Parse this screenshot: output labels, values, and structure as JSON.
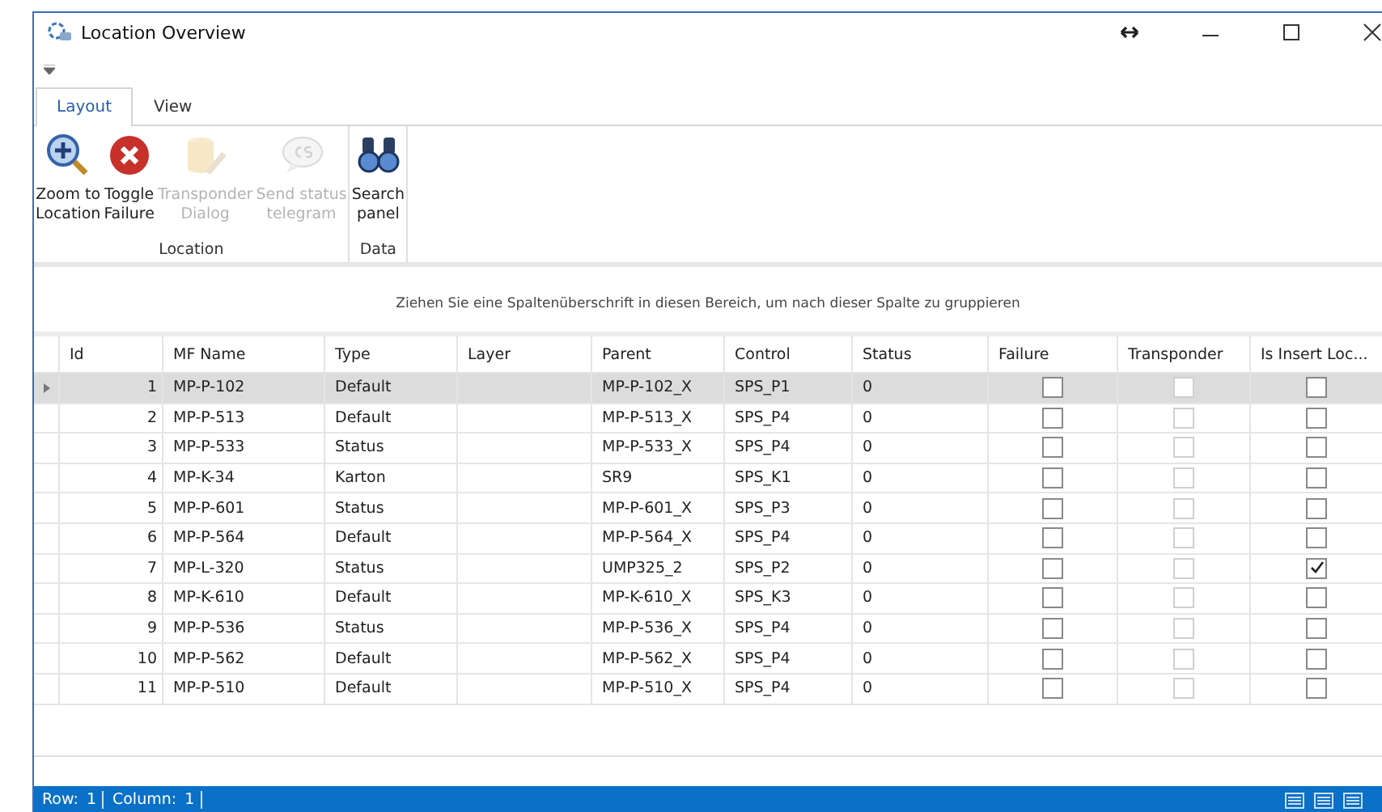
{
  "window": {
    "title": "Location Overview"
  },
  "tabs": [
    {
      "label": "Layout",
      "selected": true
    },
    {
      "label": "View",
      "selected": false
    }
  ],
  "ribbon_groups": [
    {
      "label": "Location",
      "buttons": [
        {
          "kind": "zoom",
          "lines": [
            "Zoom to",
            "Location"
          ],
          "disabled": false
        },
        {
          "kind": "failure",
          "lines": [
            "Toggle",
            "Failure"
          ],
          "disabled": false
        },
        {
          "kind": "dialog",
          "lines": [
            "Transponder",
            "Dialog"
          ],
          "disabled": true
        },
        {
          "kind": "telegram",
          "lines": [
            "Send status",
            "telegram"
          ],
          "disabled": true
        }
      ]
    },
    {
      "label": "Data",
      "buttons": [
        {
          "kind": "search",
          "lines": [
            "Search",
            "panel"
          ],
          "disabled": false
        }
      ]
    }
  ],
  "group_panel_hint": "Ziehen Sie eine Spaltenüberschrift in diesen Bereich, um nach dieser Spalte zu gruppieren",
  "table": {
    "columns": [
      {
        "label": "Id",
        "kind": "number"
      },
      {
        "label": "MF Name",
        "kind": "text"
      },
      {
        "label": "Type",
        "kind": "text"
      },
      {
        "label": "Layer",
        "kind": "text"
      },
      {
        "label": "Parent",
        "kind": "text"
      },
      {
        "label": "Control",
        "kind": "text"
      },
      {
        "label": "Status",
        "kind": "text"
      },
      {
        "label": "Failure",
        "kind": "check",
        "disabled": false
      },
      {
        "label": "Transponder",
        "kind": "check",
        "disabled": true
      },
      {
        "label": "Is Insert Loc...",
        "kind": "check",
        "disabled": false
      }
    ],
    "rows": [
      {
        "selected": true,
        "cells": [
          "1",
          "MP-P-102",
          "Default",
          "",
          "MP-P-102_X",
          "SPS_P1",
          "0"
        ],
        "checks": [
          false,
          false,
          false
        ]
      },
      {
        "selected": false,
        "cells": [
          "2",
          "MP-P-513",
          "Default",
          "",
          "MP-P-513_X",
          "SPS_P4",
          "0"
        ],
        "checks": [
          false,
          false,
          false
        ]
      },
      {
        "selected": false,
        "cells": [
          "3",
          "MP-P-533",
          "Status",
          "",
          "MP-P-533_X",
          "SPS_P4",
          "0"
        ],
        "checks": [
          false,
          false,
          false
        ]
      },
      {
        "selected": false,
        "cells": [
          "4",
          "MP-K-34",
          "Karton",
          "",
          "SR9",
          "SPS_K1",
          "0"
        ],
        "checks": [
          false,
          false,
          false
        ]
      },
      {
        "selected": false,
        "cells": [
          "5",
          "MP-P-601",
          "Status",
          "",
          "MP-P-601_X",
          "SPS_P3",
          "0"
        ],
        "checks": [
          false,
          false,
          false
        ]
      },
      {
        "selected": false,
        "cells": [
          "6",
          "MP-P-564",
          "Default",
          "",
          "MP-P-564_X",
          "SPS_P4",
          "0"
        ],
        "checks": [
          false,
          false,
          false
        ]
      },
      {
        "selected": false,
        "cells": [
          "7",
          "MP-L-320",
          "Status",
          "",
          "UMP325_2",
          "SPS_P2",
          "0"
        ],
        "checks": [
          false,
          false,
          true
        ]
      },
      {
        "selected": false,
        "cells": [
          "8",
          "MP-K-610",
          "Default",
          "",
          "MP-K-610_X",
          "SPS_K3",
          "0"
        ],
        "checks": [
          false,
          false,
          false
        ]
      },
      {
        "selected": false,
        "cells": [
          "9",
          "MP-P-536",
          "Status",
          "",
          "MP-P-536_X",
          "SPS_P4",
          "0"
        ],
        "checks": [
          false,
          false,
          false
        ]
      },
      {
        "selected": false,
        "cells": [
          "10",
          "MP-P-562",
          "Default",
          "",
          "MP-P-562_X",
          "SPS_P4",
          "0"
        ],
        "checks": [
          false,
          false,
          false
        ]
      },
      {
        "selected": false,
        "cells": [
          "11",
          "MP-P-510",
          "Default",
          "",
          "MP-P-510_X",
          "SPS_P4",
          "0"
        ],
        "checks": [
          false,
          false,
          false
        ]
      }
    ]
  },
  "status_bar": {
    "row_label": "Row:",
    "row": "1",
    "column_label": "Column:",
    "column": "1"
  }
}
